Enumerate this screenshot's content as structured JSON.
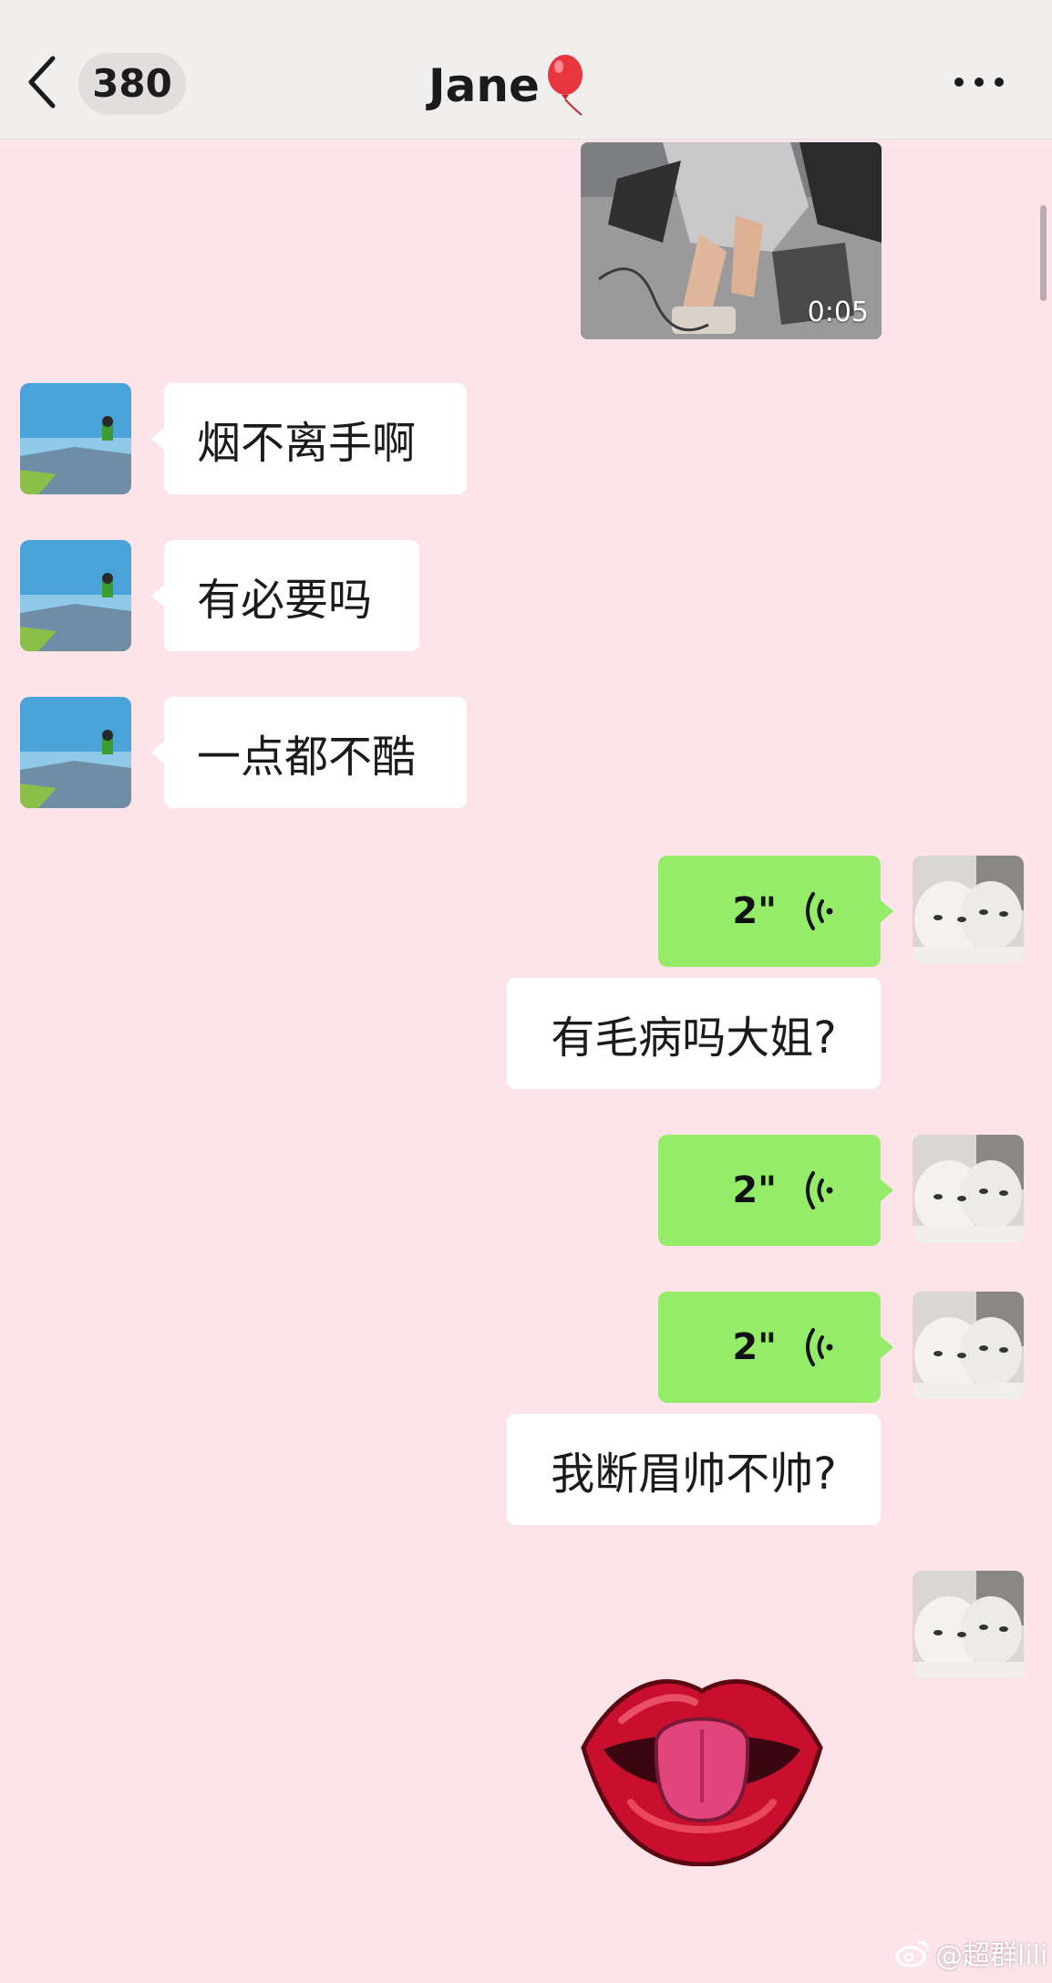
{
  "header": {
    "unread_count": "380",
    "contact_name": "Jane"
  },
  "video": {
    "duration": "0:05"
  },
  "messages": [
    {
      "side": "left",
      "type": "text",
      "text": "烟不离手啊"
    },
    {
      "side": "left",
      "type": "text",
      "text": "有必要吗"
    },
    {
      "side": "left",
      "type": "text",
      "text": "一点都不酷"
    },
    {
      "side": "right",
      "type": "voice",
      "duration": "2\""
    },
    {
      "side": "right",
      "type": "text",
      "text": "有毛病吗大姐?"
    },
    {
      "side": "right",
      "type": "voice",
      "duration": "2\""
    },
    {
      "side": "right",
      "type": "voice",
      "duration": "2\""
    },
    {
      "side": "right",
      "type": "text",
      "text": "我断眉帅不帅?"
    },
    {
      "side": "right",
      "type": "sticker",
      "sticker": "lips-tongue"
    }
  ],
  "watermark": {
    "text": "@超群lili"
  },
  "colors": {
    "chat_background": "#fce4ea",
    "header_background": "#f1eeee",
    "bubble_white": "#ffffff",
    "bubble_green": "#95ec69"
  },
  "icons": [
    "back-chevron-icon",
    "balloon-icon",
    "more-dots-icon",
    "voice-wave-icon",
    "weibo-icon"
  ]
}
